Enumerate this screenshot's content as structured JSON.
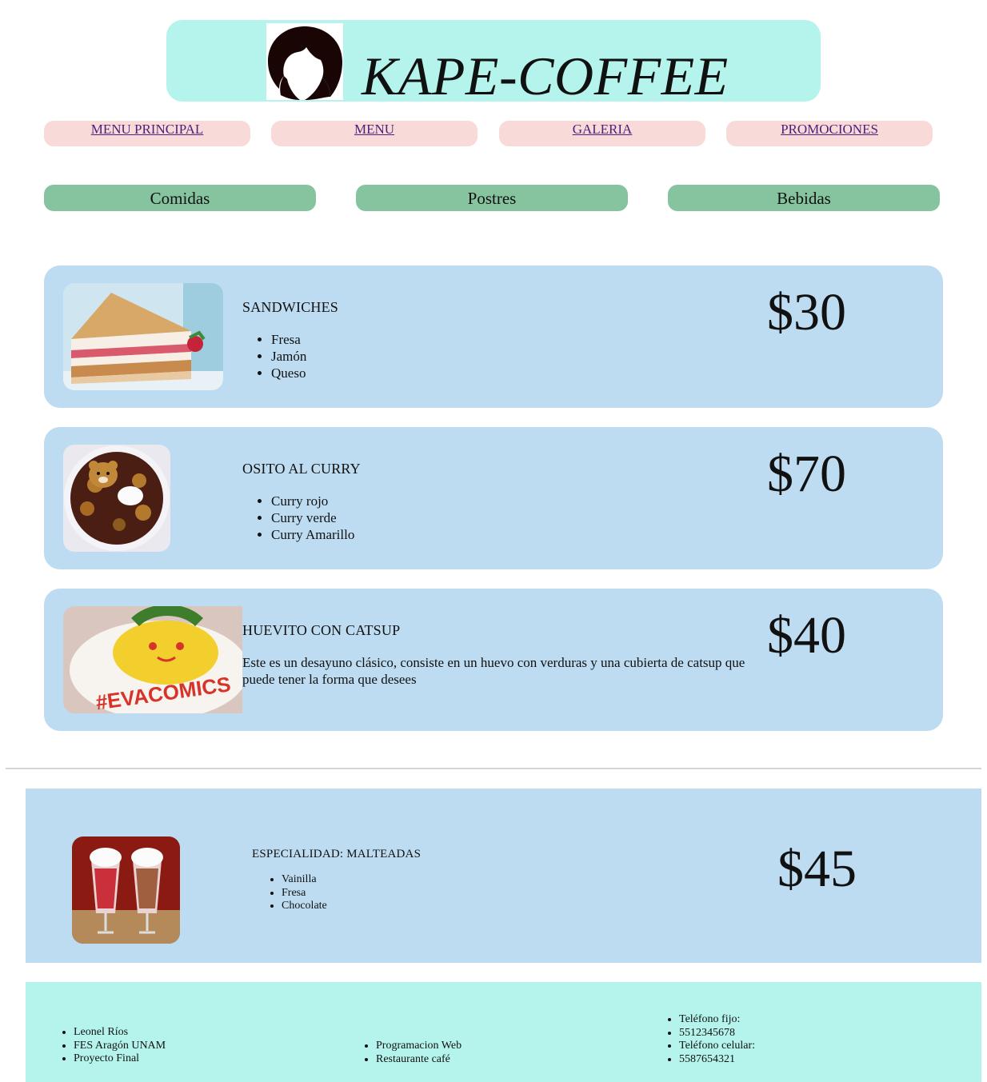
{
  "header": {
    "title": "KAPE-COFFEE",
    "logo_icon": "woman-silhouette-logo-icon"
  },
  "nav": [
    {
      "label": "MENU PRINCIPAL"
    },
    {
      "label": "MENU"
    },
    {
      "label": "GALERIA"
    },
    {
      "label": "PROMOCIONES"
    }
  ],
  "categories": [
    {
      "label": "Comidas"
    },
    {
      "label": "Postres"
    },
    {
      "label": "Bebidas"
    }
  ],
  "items": [
    {
      "name": "SANDWICHES",
      "options": [
        "Fresa",
        "Jamón",
        "Queso"
      ],
      "price": "$30",
      "image": "sandwich-photo"
    },
    {
      "name": "OSITO AL CURRY",
      "options": [
        "Curry rojo",
        "Curry verde",
        "Curry Amarillo"
      ],
      "price": "$70",
      "image": "bear-curry-photo"
    },
    {
      "name": "HUEVITO CON CATSUP",
      "description": "Este es un desayuno clásico, consiste en un huevo con verduras y una cubierta de catsup que puede tener la forma que desees",
      "price": "$40",
      "image": "omelette-photo",
      "image_text": "#EVACOMICS"
    }
  ],
  "special": {
    "name": "ESPECIALIDAD: MALTEADAS",
    "options": [
      "Vainilla",
      "Fresa",
      "Chocolate"
    ],
    "price": "$45",
    "image": "milkshakes-photo"
  },
  "footer": {
    "col1": [
      "Leonel Ríos",
      "FES Aragón UNAM",
      "Proyecto Final"
    ],
    "col2": [
      "Programacion Web",
      "Restaurante café"
    ],
    "col3": [
      "Teléfono fijo:",
      "5512345678",
      "Teléfono celular:",
      "5587654321"
    ]
  },
  "colors": {
    "header_bg": "#b4f4ec",
    "nav_bg": "#f8dbd8",
    "category_bg": "#86c4a0",
    "card_bg": "#bddcf1",
    "link": "#4b1f7a"
  }
}
